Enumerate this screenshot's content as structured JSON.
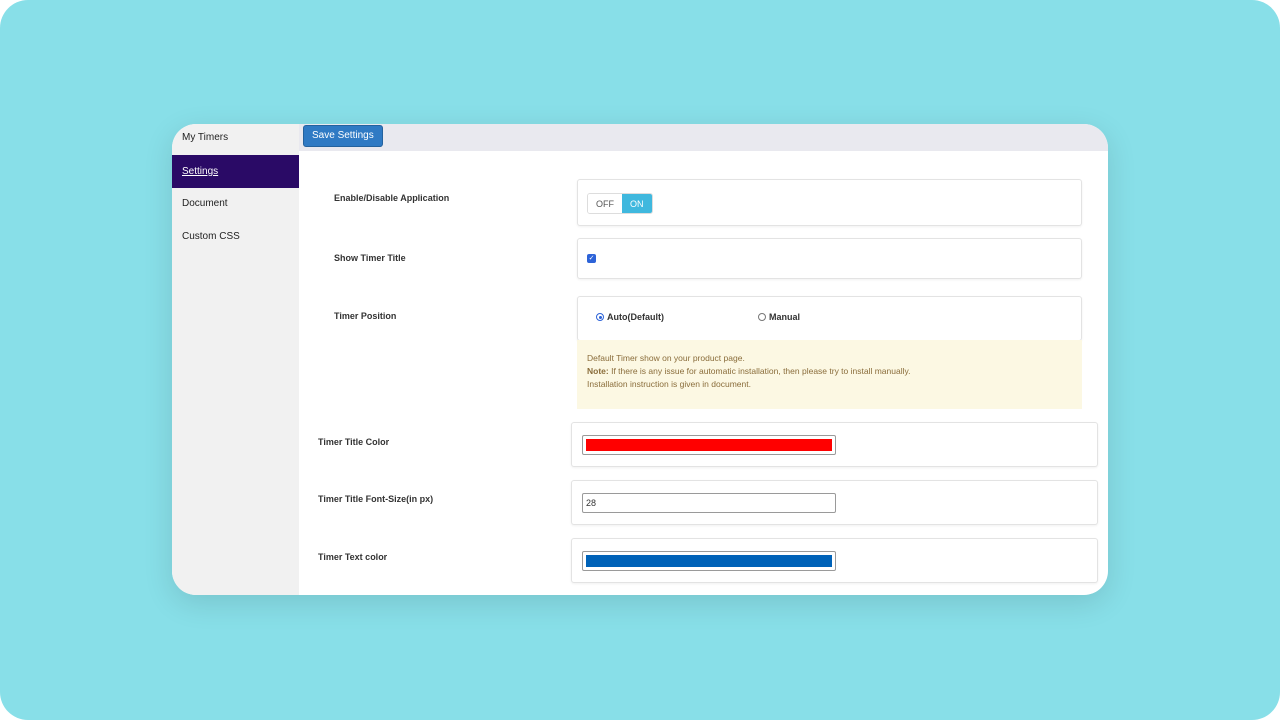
{
  "sidebar": {
    "items": [
      {
        "label": "My Timers"
      },
      {
        "label": "Settings"
      },
      {
        "label": "Document"
      },
      {
        "label": "Custom CSS"
      }
    ],
    "active_index": 1,
    "active_color": "#2a0a66"
  },
  "toolbar": {
    "save_label": "Save Settings"
  },
  "settings": {
    "enable_label": "Enable/Disable Application",
    "toggle_off": "OFF",
    "toggle_on": "ON",
    "toggle_state": "ON",
    "show_title_label": "Show Timer Title",
    "show_title_checked": true,
    "position_label": "Timer Position",
    "position_auto": "Auto(Default)",
    "position_manual": "Manual",
    "position_selected": "Auto(Default)",
    "note_line1": "Default Timer show on your product page.",
    "note_prefix": "Note:",
    "note_line2": " If there is any issue for automatic installation, then please try to install manually.",
    "note_line3": "Installation instruction is given in document.",
    "title_color_label": "Timer Title Color",
    "title_color_value": "#ff0000",
    "font_size_label": "Timer Title Font-Size(in px)",
    "font_size_value": "28",
    "text_color_label": "Timer Text color",
    "text_color_value": "#0062b8"
  }
}
